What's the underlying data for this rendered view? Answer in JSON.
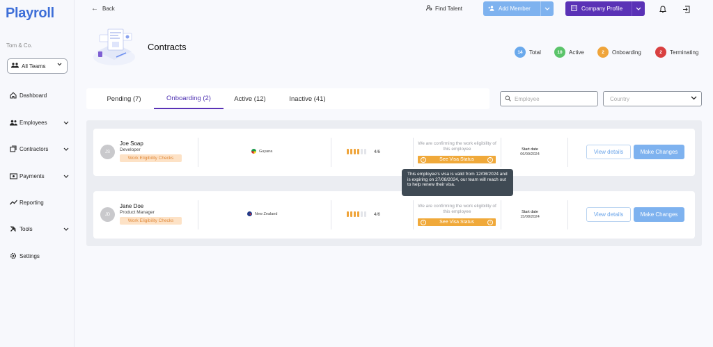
{
  "app": {
    "logo": "Playroll",
    "org": "Tom & Co."
  },
  "sidebar": {
    "team_select": "All Teams",
    "items": [
      {
        "label": "Dashboard",
        "icon": "home-icon"
      },
      {
        "label": "Employees",
        "icon": "users-icon"
      },
      {
        "label": "Contractors",
        "icon": "contract-icon"
      },
      {
        "label": "Payments",
        "icon": "payment-icon"
      },
      {
        "label": "Reporting",
        "icon": "chart-icon"
      },
      {
        "label": "Tools",
        "icon": "tools-icon"
      },
      {
        "label": "Settings",
        "icon": "gear-icon"
      }
    ]
  },
  "topbar": {
    "back_label": "Back",
    "find_talent": "Find Talent",
    "add_member": "Add Member",
    "company_profile": "Company Profile"
  },
  "page": {
    "title": "Contracts"
  },
  "stats": [
    {
      "count": "14",
      "label": "Total",
      "color": "#6aa9ec"
    },
    {
      "count": "10",
      "label": "Active",
      "color": "#5bc46a"
    },
    {
      "count": "2",
      "label": "Onboarding",
      "color": "#efa43a"
    },
    {
      "count": "2",
      "label": "Terminating",
      "color": "#d94040"
    }
  ],
  "tabs": [
    {
      "label": "Pending (7)"
    },
    {
      "label": "Onboarding (2)",
      "active": true
    },
    {
      "label": "Active (12)"
    },
    {
      "label": "Inactive (41)"
    }
  ],
  "filters": {
    "search_placeholder": "Employee",
    "country_placeholder": "Country"
  },
  "rows": [
    {
      "initials": "JS",
      "name": "Joe Soap",
      "role": "Developer",
      "badge": "Work Eligibility Checks",
      "country": "Guyana",
      "progress_done": 4,
      "progress_total": 6,
      "progress_label": "4/6",
      "confirm_text": "We are confirming the work eligibility of this employee",
      "visa_label": "See Visa Status",
      "start_label": "Start date",
      "start_date": "06/09/2024",
      "view_label": "View details",
      "make_label": "Make Changes"
    },
    {
      "initials": "JD",
      "name": "Jane Doe",
      "role": "Product Manager",
      "badge": "Work Eligibility Checks",
      "country": "New Zealand",
      "progress_done": 4,
      "progress_total": 6,
      "progress_label": "4/6",
      "confirm_text": "We are confirming the work eligibility of this employee",
      "visa_label": "See Visa Status",
      "start_label": "Start date",
      "start_date": "15/08/2024",
      "view_label": "View details",
      "make_label": "Make Changes"
    }
  ],
  "tooltip": {
    "text": "This employee's visa is valid from 12/08/2024 and is expiring on 27/08/2024, our team will reach out to help renew their visa."
  },
  "colors": {
    "accent_purple": "#5a32b6",
    "accent_blue": "#7eb2ef",
    "warning_orange": "#f0a93a"
  }
}
